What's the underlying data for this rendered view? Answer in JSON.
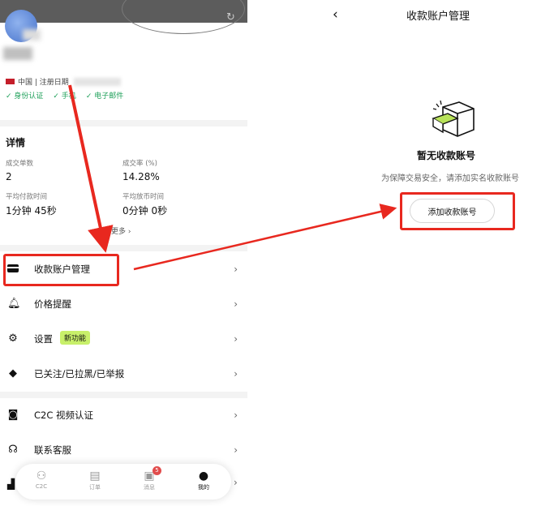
{
  "left": {
    "region_text": "中国 | 注册日期",
    "verifications": [
      "✓ 身份认证",
      "✓ 手机",
      "✓ 电子邮件"
    ],
    "details": {
      "title": "详情",
      "stats": [
        {
          "label": "成交单数",
          "value": "2"
        },
        {
          "label": "成交率 (%)",
          "value": "14.28%"
        },
        {
          "label": "平均付款时间",
          "value": "1分钟 45秒"
        },
        {
          "label": "平均放币时间",
          "value": "0分钟 0秒"
        }
      ],
      "more": "看更多 ›"
    },
    "menu": [
      {
        "label": "收款账户管理",
        "icon": "card-icon"
      },
      {
        "label": "价格提醒",
        "icon": "bell-icon"
      },
      {
        "label": "设置",
        "icon": "gear-icon",
        "badge": "新功能"
      },
      {
        "label": "已关注/已拉黑/已举报",
        "icon": "tag-icon"
      },
      {
        "label": "C2C 视频认证",
        "icon": "camera-icon"
      },
      {
        "label": "联系客服",
        "icon": "headset-icon"
      }
    ],
    "tabbar": {
      "tabs": [
        {
          "label": "C2C",
          "icon": "people-icon"
        },
        {
          "label": "订单",
          "icon": "order-icon"
        },
        {
          "label": "消息",
          "icon": "message-icon",
          "badge": "5"
        },
        {
          "label": "我的",
          "icon": "user-icon"
        }
      ]
    }
  },
  "right": {
    "title": "收款账户管理",
    "empty_title": "暂无收款账号",
    "empty_subtitle": "为保障交易安全，请添加实名收款账号",
    "add_button": "添加收款账号"
  },
  "colors": {
    "highlight": "#e8281f",
    "verify_green": "#1fa05a",
    "new_badge": "#c8f06a",
    "msg_badge": "#e24c4c"
  }
}
